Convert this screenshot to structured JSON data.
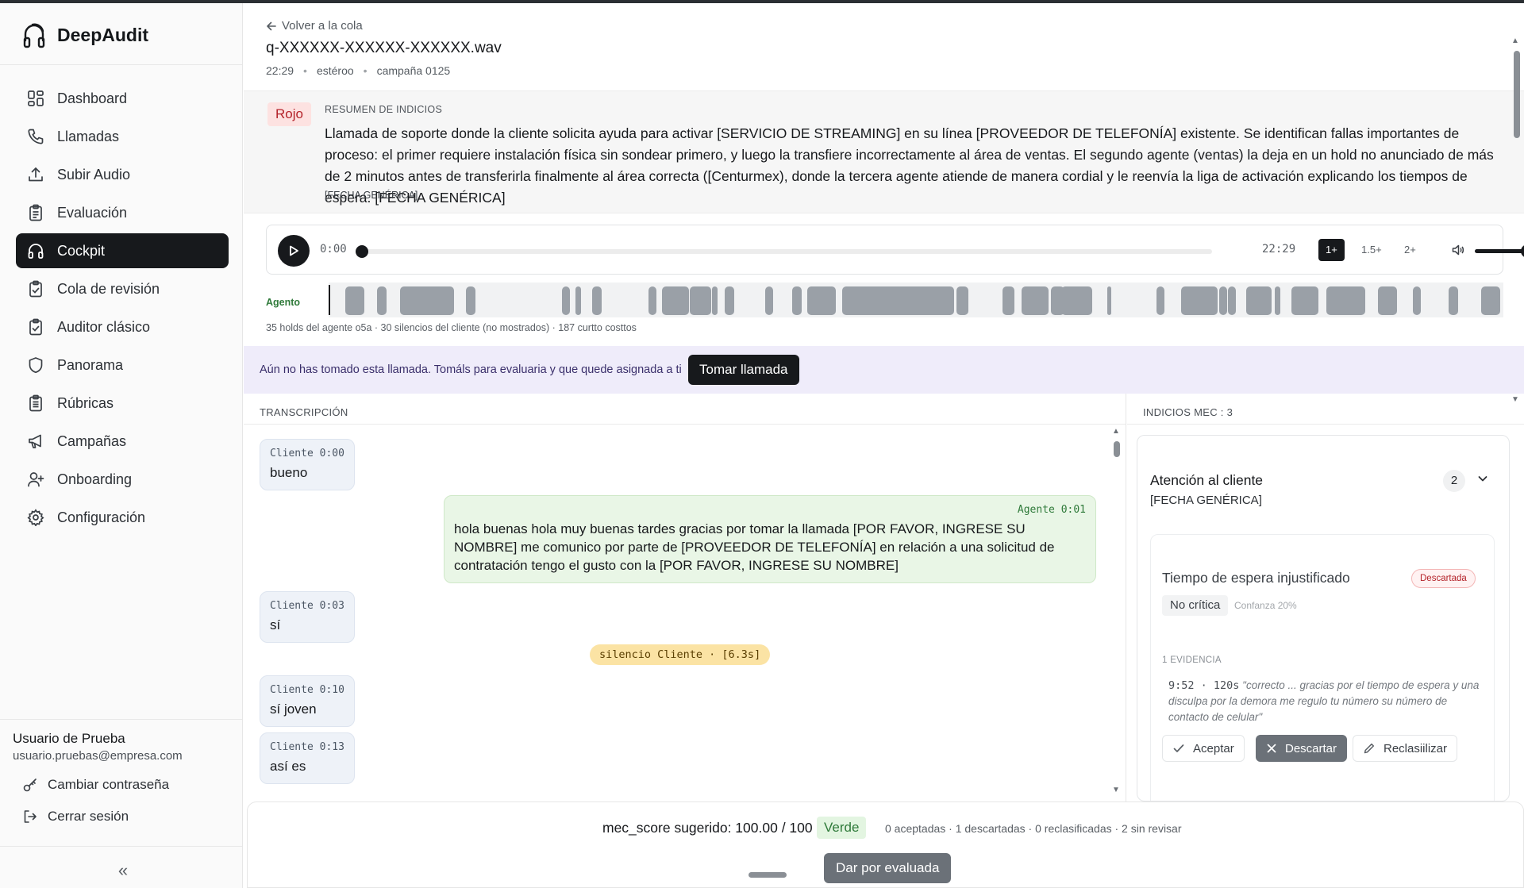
{
  "app": {
    "name": "DeepAudit"
  },
  "sidebar": {
    "items": [
      {
        "label": "Dashboard",
        "icon": "dashboard-icon"
      },
      {
        "label": "Llamadas",
        "icon": "phone-icon"
      },
      {
        "label": "Subir Audio",
        "icon": "upload-icon"
      },
      {
        "label": "Evaluación",
        "icon": "clipboard-icon"
      },
      {
        "label": "Cockpit",
        "icon": "headphones-icon",
        "active": true
      },
      {
        "label": "Cola de revisión",
        "icon": "clipboard-check-icon"
      },
      {
        "label": "Auditor clásico",
        "icon": "clipboard-check-icon"
      },
      {
        "label": "Panorama",
        "icon": "shield-icon"
      },
      {
        "label": "Rúbricas",
        "icon": "clipboard-list-icon"
      },
      {
        "label": "Campañas",
        "icon": "megaphone-icon"
      },
      {
        "label": "Onboarding",
        "icon": "user-plus-icon"
      },
      {
        "label": "Configuración",
        "icon": "gear-icon"
      }
    ],
    "user": {
      "name": "Usuario de Prueba",
      "email": "usuario.pruebas@empresa.com",
      "change_password": "Cambiar contraseña",
      "logout": "Cerrar sesión"
    },
    "collapse": "«"
  },
  "call": {
    "back": "Volver a la cola",
    "file": "q-XXXXXX-XXXXXX-XXXXXX.wav",
    "duration": "22:29",
    "channels": "estéroo",
    "campaign": "campaña 0125"
  },
  "summary": {
    "badge": "Rojo",
    "label": "RESUMEN DE INDICIOS",
    "text": "Llamada de soporte donde la cliente solicita ayuda para activar [SERVICIO DE STREAMING] en su línea [PROVEEDOR DE TELEFONÍA] existente. Se identifican fallas importantes de proceso: el primer requiere instalación física sin sondear primero, y luego la transfiere incorrectamente al área de ventas. El segundo agente (ventas) la deja en un hold no anunciado de más de 2 minutos antes de transferirla finalmente al área correcta ([Centurmex), donde la tercera agente atiende de manera cordial y le reenvía la liga de activación explicando los tiempos de espera. [FECHA GENÉRICA]",
    "footnote": "[FECHA GENÉRICA]"
  },
  "player": {
    "current": "0:00",
    "total": "22:29",
    "progress": 0,
    "volume": 1,
    "speeds": [
      {
        "label": "1+",
        "active": true
      },
      {
        "label": "1.5+",
        "active": false
      },
      {
        "label": "2+",
        "active": false
      }
    ]
  },
  "track": {
    "label": "Agento",
    "stats": "35 holds del agente o5a · 30 silencios del cliente (no mostrados) · 187 curtto costtos"
  },
  "take": {
    "text": "Aún no has tomado esta llamada. Tomáls para evaluaria y que quede asignada a ti",
    "button": "Tomar llamada"
  },
  "transcript": {
    "title": "TRANSCRIPCIÓN",
    "messages": [
      {
        "speaker": "Cliente",
        "time": "0:00",
        "text": "bueno"
      },
      {
        "speaker": "Agente",
        "time": "0:01",
        "text": "hola buenas hola muy buenas tardes gracias por tomar la llamada [POR FAVOR, INGRESE SU NOMBRE] me comunico por parte de [PROVEEDOR DE TELEFONÍA] en relación a una solicitud de contratación tengo el gusto con la [POR FAVOR, INGRESE SU NOMBRE]"
      },
      {
        "speaker": "Cliente",
        "time": "0:03",
        "text": "sí"
      },
      {
        "speaker": "Cliente",
        "time": "0:10",
        "text": "sí joven"
      },
      {
        "speaker": "Cliente",
        "time": "0:13",
        "text": "así es"
      }
    ],
    "silence": "silencio Cliente · [6.3s]"
  },
  "indicios": {
    "title": "INDICIOS MEC : 3",
    "category": {
      "title": "Atención al cliente",
      "subtitle": "[FECHA GENÉRICA]",
      "count": "2"
    },
    "item": {
      "title": "Tiempo de espera injustificado",
      "status": "Descartada",
      "severity": "No crítica",
      "confidence": "Confanza 20%",
      "evidence_label": "1 EVIDENCIA",
      "evidence_time": "9:52 · 120s",
      "evidence_quote": "\"correcto ... gracias por el tiempo de espera y una disculpa por la demora me regulo tu número su número de contacto de celular\"",
      "accept": "Aceptar",
      "discard": "Descartar",
      "reclassify": "Reclasiilizar"
    }
  },
  "footer": {
    "score": "mec_score sugerido: 100.00 / 100",
    "badge": "Verde",
    "counts": "0 aceptadas · 1 descartadas · 0 reclasificadas · 2 sin revisar",
    "button": "Dar por evaluada"
  },
  "colors": {
    "accent_dark": "#17191c",
    "rojo_bg": "#fde2e1",
    "verde_bg": "#e3f5e1",
    "banner_bg": "#efecfa",
    "agent_bubble": "#e9f6e6",
    "client_bubble": "#eef2f8",
    "silence": "#fbe3a4"
  }
}
